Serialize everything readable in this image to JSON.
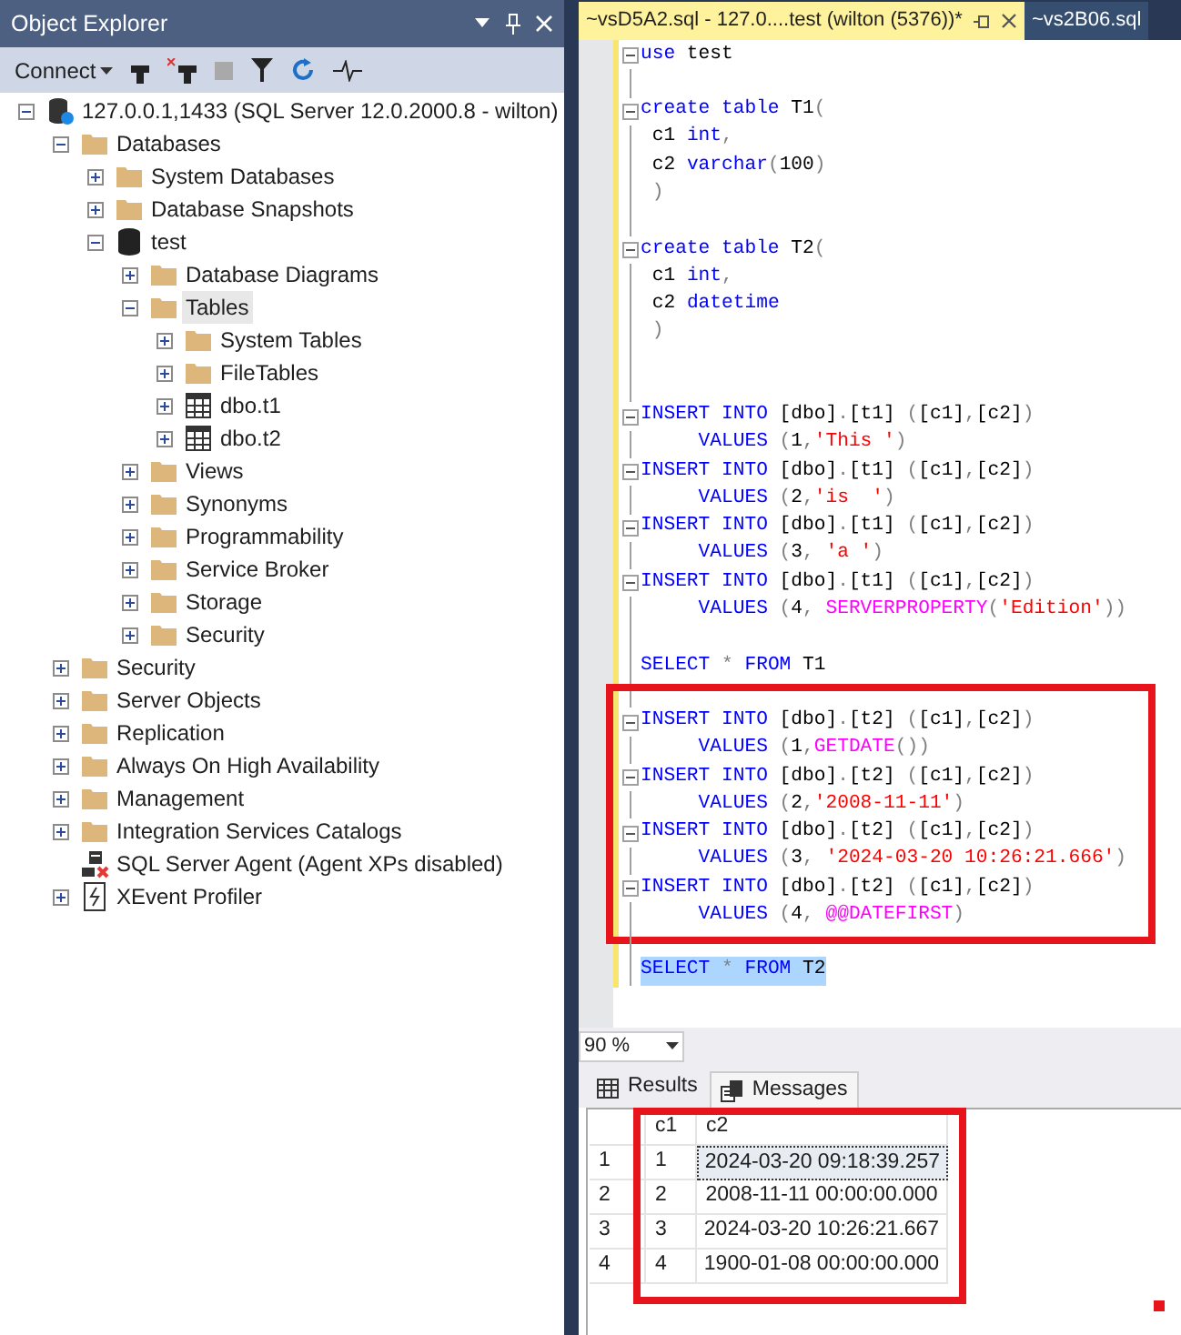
{
  "object_explorer": {
    "title": "Object Explorer",
    "toolbar": {
      "connect": "Connect"
    },
    "tree": [
      {
        "label": "127.0.0.1,1433 (SQL Server 12.0.2000.8 - wilton)",
        "kind": "server",
        "expanded": true,
        "selected": false,
        "children": [
          {
            "label": "Databases",
            "kind": "folder",
            "expanded": true,
            "selected": false,
            "children": [
              {
                "label": "System Databases",
                "kind": "folder",
                "expanded": false,
                "selected": false
              },
              {
                "label": "Database Snapshots",
                "kind": "folder",
                "expanded": false,
                "selected": false
              },
              {
                "label": "test",
                "kind": "database",
                "expanded": true,
                "selected": false,
                "children": [
                  {
                    "label": "Database Diagrams",
                    "kind": "folder",
                    "expanded": false,
                    "selected": false
                  },
                  {
                    "label": "Tables",
                    "kind": "folder",
                    "expanded": true,
                    "selected": true,
                    "children": [
                      {
                        "label": "System Tables",
                        "kind": "folder",
                        "expanded": false,
                        "selected": false
                      },
                      {
                        "label": "FileTables",
                        "kind": "folder",
                        "expanded": false,
                        "selected": false
                      },
                      {
                        "label": "dbo.t1",
                        "kind": "table",
                        "expanded": false,
                        "selected": false
                      },
                      {
                        "label": "dbo.t2",
                        "kind": "table",
                        "expanded": false,
                        "selected": false
                      }
                    ]
                  },
                  {
                    "label": "Views",
                    "kind": "folder",
                    "expanded": false,
                    "selected": false
                  },
                  {
                    "label": "Synonyms",
                    "kind": "folder",
                    "expanded": false,
                    "selected": false
                  },
                  {
                    "label": "Programmability",
                    "kind": "folder",
                    "expanded": false,
                    "selected": false
                  },
                  {
                    "label": "Service Broker",
                    "kind": "folder",
                    "expanded": false,
                    "selected": false
                  },
                  {
                    "label": "Storage",
                    "kind": "folder",
                    "expanded": false,
                    "selected": false
                  },
                  {
                    "label": "Security",
                    "kind": "folder",
                    "expanded": false,
                    "selected": false
                  }
                ]
              }
            ]
          },
          {
            "label": "Security",
            "kind": "folder",
            "expanded": false,
            "selected": false
          },
          {
            "label": "Server Objects",
            "kind": "folder",
            "expanded": false,
            "selected": false
          },
          {
            "label": "Replication",
            "kind": "folder",
            "expanded": false,
            "selected": false
          },
          {
            "label": "Always On High Availability",
            "kind": "folder",
            "expanded": false,
            "selected": false
          },
          {
            "label": "Management",
            "kind": "folder",
            "expanded": false,
            "selected": false
          },
          {
            "label": "Integration Services Catalogs",
            "kind": "folder",
            "expanded": false,
            "selected": false
          },
          {
            "label": "SQL Server Agent (Agent XPs disabled)",
            "kind": "agent",
            "selected": false
          },
          {
            "label": "XEvent Profiler",
            "kind": "xevent",
            "expanded": false,
            "selected": false
          }
        ]
      }
    ]
  },
  "editor_tabs": [
    {
      "label": "~vsD5A2.sql - 127.0....test (wilton (5376))*",
      "selected": true
    },
    {
      "label": "~vs2B06.sql",
      "selected": false
    }
  ],
  "code_blocks": [
    {
      "lines": [
        {
          "fold": true,
          "selected": false,
          "tokens": [
            {
              "kind": "keyword",
              "text": "use"
            },
            {
              "kind": "plain",
              "text": " test"
            }
          ]
        },
        {
          "fold": false
        },
        {
          "fold": true,
          "selected": false,
          "tokens": [
            {
              "kind": "keyword",
              "text": "create table"
            },
            {
              "kind": "plain",
              "text": " T1"
            },
            {
              "kind": "punct",
              "text": "("
            }
          ]
        },
        {
          "fold": false,
          "selected": false,
          "tokens": [
            {
              "kind": "plain",
              "text": " c1 "
            },
            {
              "kind": "keyword",
              "text": "int"
            },
            {
              "kind": "punct",
              "text": ","
            }
          ]
        },
        {
          "fold": false,
          "selected": false,
          "tokens": [
            {
              "kind": "plain",
              "text": " c2 "
            },
            {
              "kind": "keyword",
              "text": "varchar"
            },
            {
              "kind": "punct",
              "text": "("
            },
            {
              "kind": "plain",
              "text": "100"
            },
            {
              "kind": "punct",
              "text": ")"
            }
          ]
        },
        {
          "fold": false,
          "selected": false,
          "tokens": [
            {
              "kind": "punct",
              "text": " )"
            }
          ]
        },
        {
          "fold": false
        },
        {
          "fold": true,
          "selected": false,
          "tokens": [
            {
              "kind": "keyword",
              "text": "create table"
            },
            {
              "kind": "plain",
              "text": " T2"
            },
            {
              "kind": "punct",
              "text": "("
            }
          ]
        },
        {
          "fold": false,
          "selected": false,
          "tokens": [
            {
              "kind": "plain",
              "text": " c1 "
            },
            {
              "kind": "keyword",
              "text": "int"
            },
            {
              "kind": "punct",
              "text": ","
            }
          ]
        },
        {
          "fold": false,
          "selected": false,
          "tokens": [
            {
              "kind": "plain",
              "text": " c2 "
            },
            {
              "kind": "keyword",
              "text": "datetime"
            }
          ]
        },
        {
          "fold": false,
          "selected": false,
          "tokens": [
            {
              "kind": "punct",
              "text": " )"
            }
          ]
        },
        {
          "fold": false
        },
        {
          "fold": false
        },
        {
          "fold": true,
          "selected": false,
          "tokens": [
            {
              "kind": "keyword",
              "text": "INSERT INTO"
            },
            {
              "kind": "plain",
              "text": " [dbo]"
            },
            {
              "kind": "punct",
              "text": "."
            },
            {
              "kind": "plain",
              "text": "[t1] "
            },
            {
              "kind": "punct",
              "text": "("
            },
            {
              "kind": "plain",
              "text": "[c1]"
            },
            {
              "kind": "punct",
              "text": ","
            },
            {
              "kind": "plain",
              "text": "[c2]"
            },
            {
              "kind": "punct",
              "text": ")"
            }
          ]
        },
        {
          "fold": false,
          "selected": false,
          "tokens": [
            {
              "kind": "keyword",
              "text": "     VALUES"
            },
            {
              "kind": "punct",
              "text": " ("
            },
            {
              "kind": "plain",
              "text": "1"
            },
            {
              "kind": "punct",
              "text": ","
            },
            {
              "kind": "string",
              "text": "'This '"
            },
            {
              "kind": "punct",
              "text": ")"
            }
          ]
        },
        {
          "fold": true,
          "selected": false,
          "tokens": [
            {
              "kind": "keyword",
              "text": "INSERT INTO"
            },
            {
              "kind": "plain",
              "text": " [dbo]"
            },
            {
              "kind": "punct",
              "text": "."
            },
            {
              "kind": "plain",
              "text": "[t1] "
            },
            {
              "kind": "punct",
              "text": "("
            },
            {
              "kind": "plain",
              "text": "[c1]"
            },
            {
              "kind": "punct",
              "text": ","
            },
            {
              "kind": "plain",
              "text": "[c2]"
            },
            {
              "kind": "punct",
              "text": ")"
            }
          ]
        },
        {
          "fold": false,
          "selected": false,
          "tokens": [
            {
              "kind": "keyword",
              "text": "     VALUES"
            },
            {
              "kind": "punct",
              "text": " ("
            },
            {
              "kind": "plain",
              "text": "2"
            },
            {
              "kind": "punct",
              "text": ","
            },
            {
              "kind": "string",
              "text": "'is  '"
            },
            {
              "kind": "punct",
              "text": ")"
            }
          ]
        },
        {
          "fold": true,
          "selected": false,
          "tokens": [
            {
              "kind": "keyword",
              "text": "INSERT INTO"
            },
            {
              "kind": "plain",
              "text": " [dbo]"
            },
            {
              "kind": "punct",
              "text": "."
            },
            {
              "kind": "plain",
              "text": "[t1] "
            },
            {
              "kind": "punct",
              "text": "("
            },
            {
              "kind": "plain",
              "text": "[c1]"
            },
            {
              "kind": "punct",
              "text": ","
            },
            {
              "kind": "plain",
              "text": "[c2]"
            },
            {
              "kind": "punct",
              "text": ")"
            }
          ]
        },
        {
          "fold": false,
          "selected": false,
          "tokens": [
            {
              "kind": "keyword",
              "text": "     VALUES"
            },
            {
              "kind": "punct",
              "text": " ("
            },
            {
              "kind": "plain",
              "text": "3"
            },
            {
              "kind": "punct",
              "text": ", "
            },
            {
              "kind": "string",
              "text": "'a '"
            },
            {
              "kind": "punct",
              "text": ")"
            }
          ]
        },
        {
          "fold": true,
          "selected": false,
          "tokens": [
            {
              "kind": "keyword",
              "text": "INSERT INTO"
            },
            {
              "kind": "plain",
              "text": " [dbo]"
            },
            {
              "kind": "punct",
              "text": "."
            },
            {
              "kind": "plain",
              "text": "[t1] "
            },
            {
              "kind": "punct",
              "text": "("
            },
            {
              "kind": "plain",
              "text": "[c1]"
            },
            {
              "kind": "punct",
              "text": ","
            },
            {
              "kind": "plain",
              "text": "[c2]"
            },
            {
              "kind": "punct",
              "text": ")"
            }
          ]
        },
        {
          "fold": false,
          "selected": false,
          "tokens": [
            {
              "kind": "keyword",
              "text": "     VALUES"
            },
            {
              "kind": "punct",
              "text": " ("
            },
            {
              "kind": "plain",
              "text": "4"
            },
            {
              "kind": "punct",
              "text": ", "
            },
            {
              "kind": "function",
              "text": "SERVERPROPERTY"
            },
            {
              "kind": "punct",
              "text": "("
            },
            {
              "kind": "string",
              "text": "'Edition'"
            },
            {
              "kind": "punct",
              "text": "))"
            }
          ]
        },
        {
          "fold": false
        },
        {
          "fold": false,
          "selected": false,
          "tokens": [
            {
              "kind": "keyword",
              "text": "SELECT"
            },
            {
              "kind": "punct",
              "text": " * "
            },
            {
              "kind": "keyword",
              "text": "FROM"
            },
            {
              "kind": "plain",
              "text": " T1"
            }
          ]
        },
        {
          "fold": false
        }
      ]
    },
    {
      "highlighted": true,
      "lines": [
        {
          "fold": true,
          "selected": false,
          "tokens": [
            {
              "kind": "keyword",
              "text": "INSERT INTO"
            },
            {
              "kind": "plain",
              "text": " [dbo]"
            },
            {
              "kind": "punct",
              "text": "."
            },
            {
              "kind": "plain",
              "text": "[t2] "
            },
            {
              "kind": "punct",
              "text": "("
            },
            {
              "kind": "plain",
              "text": "[c1]"
            },
            {
              "kind": "punct",
              "text": ","
            },
            {
              "kind": "plain",
              "text": "[c2]"
            },
            {
              "kind": "punct",
              "text": ")"
            }
          ]
        },
        {
          "fold": false,
          "selected": false,
          "tokens": [
            {
              "kind": "keyword",
              "text": "     VALUES"
            },
            {
              "kind": "punct",
              "text": " ("
            },
            {
              "kind": "plain",
              "text": "1"
            },
            {
              "kind": "punct",
              "text": ","
            },
            {
              "kind": "function",
              "text": "GETDATE"
            },
            {
              "kind": "punct",
              "text": "())"
            }
          ]
        },
        {
          "fold": true,
          "selected": false,
          "tokens": [
            {
              "kind": "keyword",
              "text": "INSERT INTO"
            },
            {
              "kind": "plain",
              "text": " [dbo]"
            },
            {
              "kind": "punct",
              "text": "."
            },
            {
              "kind": "plain",
              "text": "[t2] "
            },
            {
              "kind": "punct",
              "text": "("
            },
            {
              "kind": "plain",
              "text": "[c1]"
            },
            {
              "kind": "punct",
              "text": ","
            },
            {
              "kind": "plain",
              "text": "[c2]"
            },
            {
              "kind": "punct",
              "text": ")"
            }
          ]
        },
        {
          "fold": false,
          "selected": false,
          "tokens": [
            {
              "kind": "keyword",
              "text": "     VALUES"
            },
            {
              "kind": "punct",
              "text": " ("
            },
            {
              "kind": "plain",
              "text": "2"
            },
            {
              "kind": "punct",
              "text": ","
            },
            {
              "kind": "string",
              "text": "'2008-11-11'"
            },
            {
              "kind": "punct",
              "text": ")"
            }
          ]
        },
        {
          "fold": true,
          "selected": false,
          "tokens": [
            {
              "kind": "keyword",
              "text": "INSERT INTO"
            },
            {
              "kind": "plain",
              "text": " [dbo]"
            },
            {
              "kind": "punct",
              "text": "."
            },
            {
              "kind": "plain",
              "text": "[t2] "
            },
            {
              "kind": "punct",
              "text": "("
            },
            {
              "kind": "plain",
              "text": "[c1]"
            },
            {
              "kind": "punct",
              "text": ","
            },
            {
              "kind": "plain",
              "text": "[c2]"
            },
            {
              "kind": "punct",
              "text": ")"
            }
          ]
        },
        {
          "fold": false,
          "selected": false,
          "tokens": [
            {
              "kind": "keyword",
              "text": "     VALUES"
            },
            {
              "kind": "punct",
              "text": " ("
            },
            {
              "kind": "plain",
              "text": "3"
            },
            {
              "kind": "punct",
              "text": ", "
            },
            {
              "kind": "string",
              "text": "'2024-03-20 10:26:21.666'"
            },
            {
              "kind": "punct",
              "text": ")"
            }
          ]
        },
        {
          "fold": true,
          "selected": false,
          "tokens": [
            {
              "kind": "keyword",
              "text": "INSERT INTO"
            },
            {
              "kind": "plain",
              "text": " [dbo]"
            },
            {
              "kind": "punct",
              "text": "."
            },
            {
              "kind": "plain",
              "text": "[t2] "
            },
            {
              "kind": "punct",
              "text": "("
            },
            {
              "kind": "plain",
              "text": "[c1]"
            },
            {
              "kind": "punct",
              "text": ","
            },
            {
              "kind": "plain",
              "text": "[c2]"
            },
            {
              "kind": "punct",
              "text": ")"
            }
          ]
        },
        {
          "fold": false,
          "selected": false,
          "tokens": [
            {
              "kind": "keyword",
              "text": "     VALUES"
            },
            {
              "kind": "punct",
              "text": " ("
            },
            {
              "kind": "plain",
              "text": "4"
            },
            {
              "kind": "punct",
              "text": ", "
            },
            {
              "kind": "function",
              "text": "@@DATEFIRST"
            },
            {
              "kind": "punct",
              "text": ")"
            }
          ]
        }
      ]
    },
    {
      "lines": [
        {
          "fold": false
        },
        {
          "fold": false,
          "selected": true,
          "tokens": [
            {
              "kind": "keyword",
              "text": "SELECT"
            },
            {
              "kind": "punct",
              "text": " * "
            },
            {
              "kind": "keyword",
              "text": "FROM"
            },
            {
              "kind": "plain",
              "text": " T2"
            }
          ]
        }
      ]
    }
  ],
  "zoom": "90 %",
  "result_tabs": [
    {
      "label": "Results",
      "kind": "grid",
      "selected": true
    },
    {
      "label": "Messages",
      "kind": "messages",
      "selected": false
    }
  ],
  "results": {
    "highlighted": true,
    "columns": [
      "c1",
      "c2"
    ],
    "rows": [
      {
        "number": "1",
        "c1": "1",
        "c2": "2024-03-20 09:18:39.257",
        "focused": true
      },
      {
        "number": "2",
        "c1": "2",
        "c2": "2008-11-11 00:00:00.000",
        "focused": false
      },
      {
        "number": "3",
        "c1": "3",
        "c2": "2024-03-20 10:26:21.667",
        "focused": false
      },
      {
        "number": "4",
        "c1": "4",
        "c2": "1900-01-08 00:00:00.000",
        "focused": false
      }
    ]
  }
}
